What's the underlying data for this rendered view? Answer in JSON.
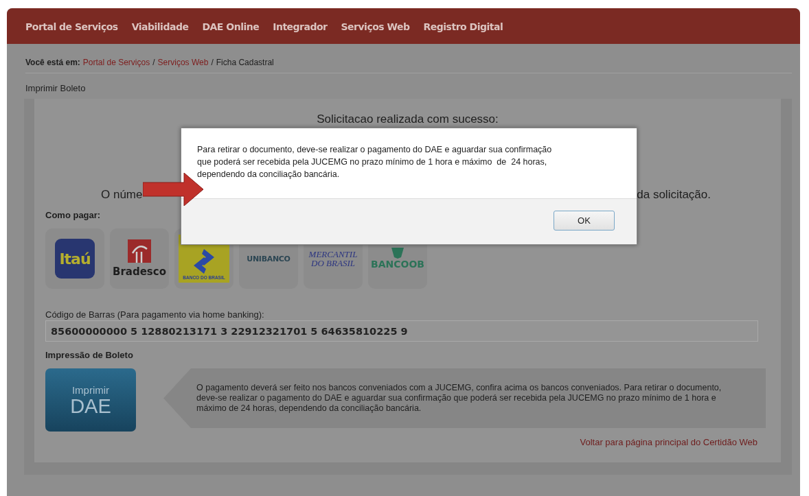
{
  "nav": {
    "items": [
      "Portal de Serviços",
      "Viabilidade",
      "DAE Online",
      "Integrador",
      "Serviços Web",
      "Registro Digital"
    ]
  },
  "breadcrumb": {
    "label": "Você está em:",
    "links": [
      "Portal de Serviços",
      "Serviços Web"
    ],
    "separators": [
      "/",
      "/"
    ],
    "current": "Ficha Cadastral"
  },
  "section_title": "Imprimir Boleto",
  "status": {
    "message": "Solicitacao realizada com sucesso:",
    "line_start": "O núme",
    "line_end": "da solicitação."
  },
  "payment": {
    "title": "Como pagar:",
    "banks": [
      {
        "kind": "itau",
        "lines": [
          "Itaú"
        ]
      },
      {
        "kind": "bradesco",
        "lines": [
          "Bradesco"
        ]
      },
      {
        "kind": "bb",
        "lines": [
          "BANCO DO BRASIL"
        ]
      },
      {
        "kind": "unibanco",
        "lines": [
          "UNIBANCO"
        ]
      },
      {
        "kind": "mercantil",
        "lines": [
          "MERCANTIL",
          "DO BRASIL"
        ]
      },
      {
        "kind": "bancoob",
        "lines": [
          "BANCOOB"
        ]
      }
    ]
  },
  "barcode": {
    "label": "Código de Barras (Para pagamento via home banking):",
    "value": "85600000000 5 12880213171 3 22912321701 5 64635810225 9"
  },
  "print": {
    "title": "Impressão de Boleto",
    "button_lines": [
      "Imprimir",
      "DAE"
    ],
    "info": "O pagamento deverá ser feito nos bancos conveniados com a JUCEMG, confira acima os bancos conveniados. Para retirar o documento, deve-se realizar o pagamento do DAE e aguardar sua confirmação que poderá ser recebida pela JUCEMG no prazo mínimo de 1 hora e máximo de 24 horas, dependendo da conciliação bancária.",
    "back_link": "Voltar para página principal do Certidão Web"
  },
  "dialog": {
    "lines": [
      "Para retirar o documento, deve-se realizar o pagamento do DAE e aguardar sua confirmação",
      "que poderá ser recebida pela JUCEMG no prazo mínimo de 1 hora e máximo  de  24 horas,",
      "dependendo da conciliação bancária."
    ],
    "ok": "OK"
  }
}
